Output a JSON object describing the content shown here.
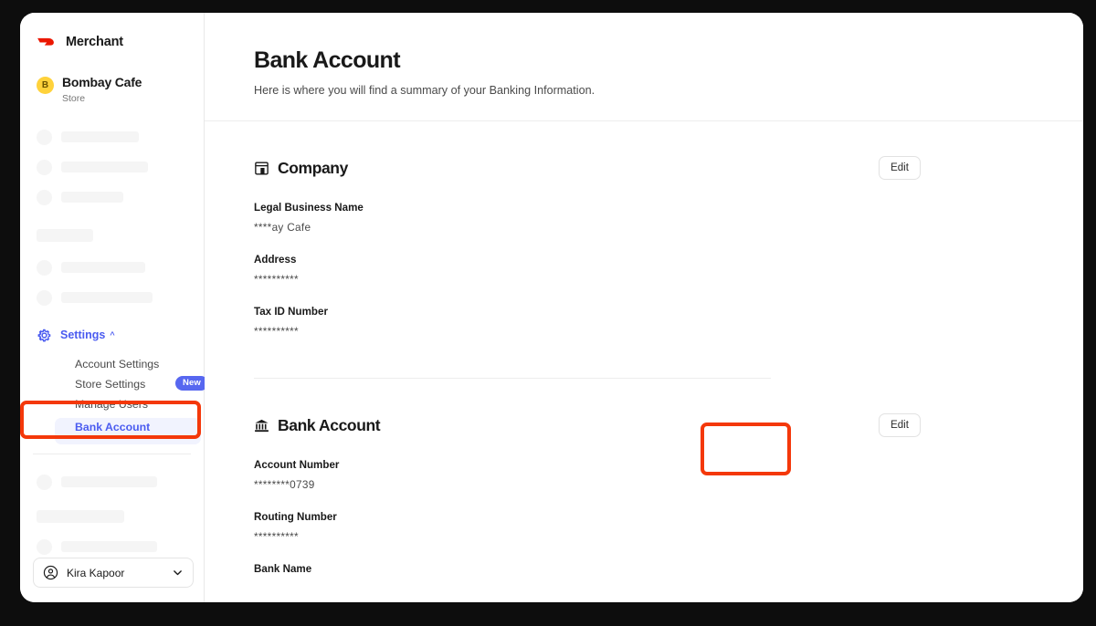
{
  "sidebar": {
    "brand": {
      "logo_icon": "doordash-logo-icon",
      "label": "Merchant"
    },
    "store": {
      "avatar_letter": "B",
      "name": "Bombay Cafe",
      "type": "Store"
    },
    "settings": {
      "icon": "gear-icon",
      "label": "Settings",
      "caret": "^",
      "items": [
        {
          "label": "Account Settings",
          "badge": null,
          "active": false
        },
        {
          "label": "Store Settings",
          "badge": "New",
          "active": false
        },
        {
          "label": "Manage Users",
          "badge": null,
          "active": false
        },
        {
          "label": "Bank Account",
          "badge": null,
          "active": true
        }
      ]
    },
    "user": {
      "icon": "account-circle-icon",
      "name": "Kira Kapoor",
      "chevron": "chevron-down-icon"
    }
  },
  "header": {
    "title": "Bank Account",
    "subtitle": "Here is where you will find a summary of your Banking Information."
  },
  "sections": [
    {
      "icon": "storefront-icon",
      "title": "Company",
      "edit_label": "Edit",
      "fields": [
        {
          "label": "Legal Business Name",
          "value": "****ay Cafe"
        },
        {
          "label": "Address",
          "value": "**********"
        },
        {
          "label": "Tax ID Number",
          "value": "**********"
        }
      ]
    },
    {
      "icon": "bank-icon",
      "title": "Bank Account",
      "edit_label": "Edit",
      "fields": [
        {
          "label": "Account Number",
          "value": "********0739"
        },
        {
          "label": "Routing Number",
          "value": "**********"
        },
        {
          "label": "Bank Name",
          "value": ""
        }
      ]
    }
  ],
  "colors": {
    "brand_red": "#EB1700",
    "accent_blue": "#4b5cf0",
    "badge_blue": "#5767f0",
    "annotation_red": "#F4380A",
    "avatar_yellow": "#FFD23B"
  }
}
